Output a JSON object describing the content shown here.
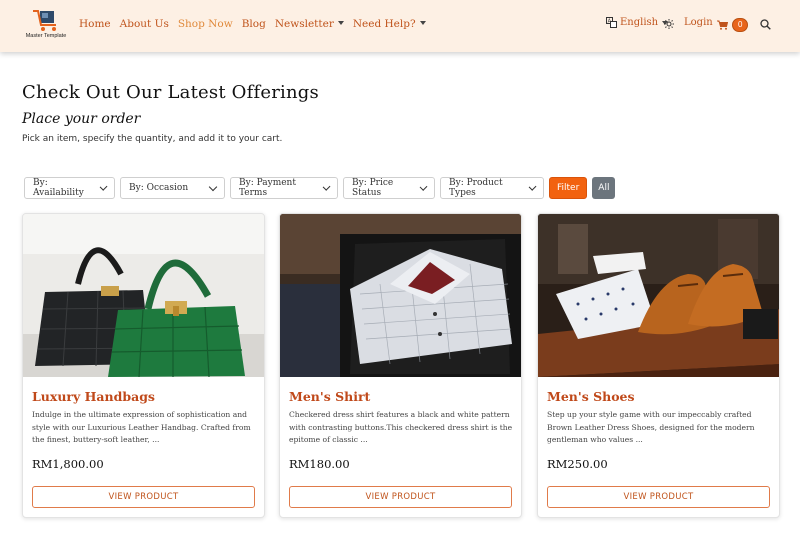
{
  "brand": {
    "logo_text": "Master Template"
  },
  "nav": {
    "items": [
      {
        "label": "Home",
        "has_dropdown": false
      },
      {
        "label": "About Us",
        "has_dropdown": false
      },
      {
        "label": "Shop Now",
        "has_dropdown": false,
        "active": true
      },
      {
        "label": "Blog",
        "has_dropdown": false
      },
      {
        "label": "Newsletter",
        "has_dropdown": true
      },
      {
        "label": "Need Help?",
        "has_dropdown": true
      }
    ],
    "language": "English",
    "login": "Login",
    "cart_count": "0",
    "icons": [
      "translate-icon",
      "theme-sun-icon",
      "cart-icon",
      "search-icon"
    ]
  },
  "header": {
    "title": "Check Out Our Latest Offerings",
    "subtitle": "Place your order",
    "description": "Pick an item, specify the quantity, and add it to your cart."
  },
  "filters": {
    "selects": [
      "By: Availability",
      "By: Occasion",
      "By: Payment Terms",
      "By: Price Status",
      "By: Product Types"
    ],
    "filter_label": "Filter",
    "all_label": "All"
  },
  "products": [
    {
      "title": "Luxury Handbags",
      "description": "Indulge in the ultimate expression of sophistication and style with our Luxurious Leather Handbag. Crafted from the finest, buttery-soft leather, ...",
      "price": "RM1,800.00",
      "button": "VIEW PRODUCT"
    },
    {
      "title": "Men's Shirt",
      "description": "Checkered dress shirt features a black and white pattern with contrasting buttons.This checkered dress shirt is the epitome of classic ...",
      "price": "RM180.00",
      "button": "VIEW PRODUCT"
    },
    {
      "title": "Men's Shoes",
      "description": "Step up your style game with our impeccably crafted Brown Leather Dress Shoes, designed for the modern gentleman who values ...",
      "price": "RM250.00",
      "button": "VIEW PRODUCT"
    }
  ],
  "colors": {
    "accent": "#c0541c",
    "filter_button": "#f2620f",
    "nav_bg": "#fdf0e4"
  }
}
